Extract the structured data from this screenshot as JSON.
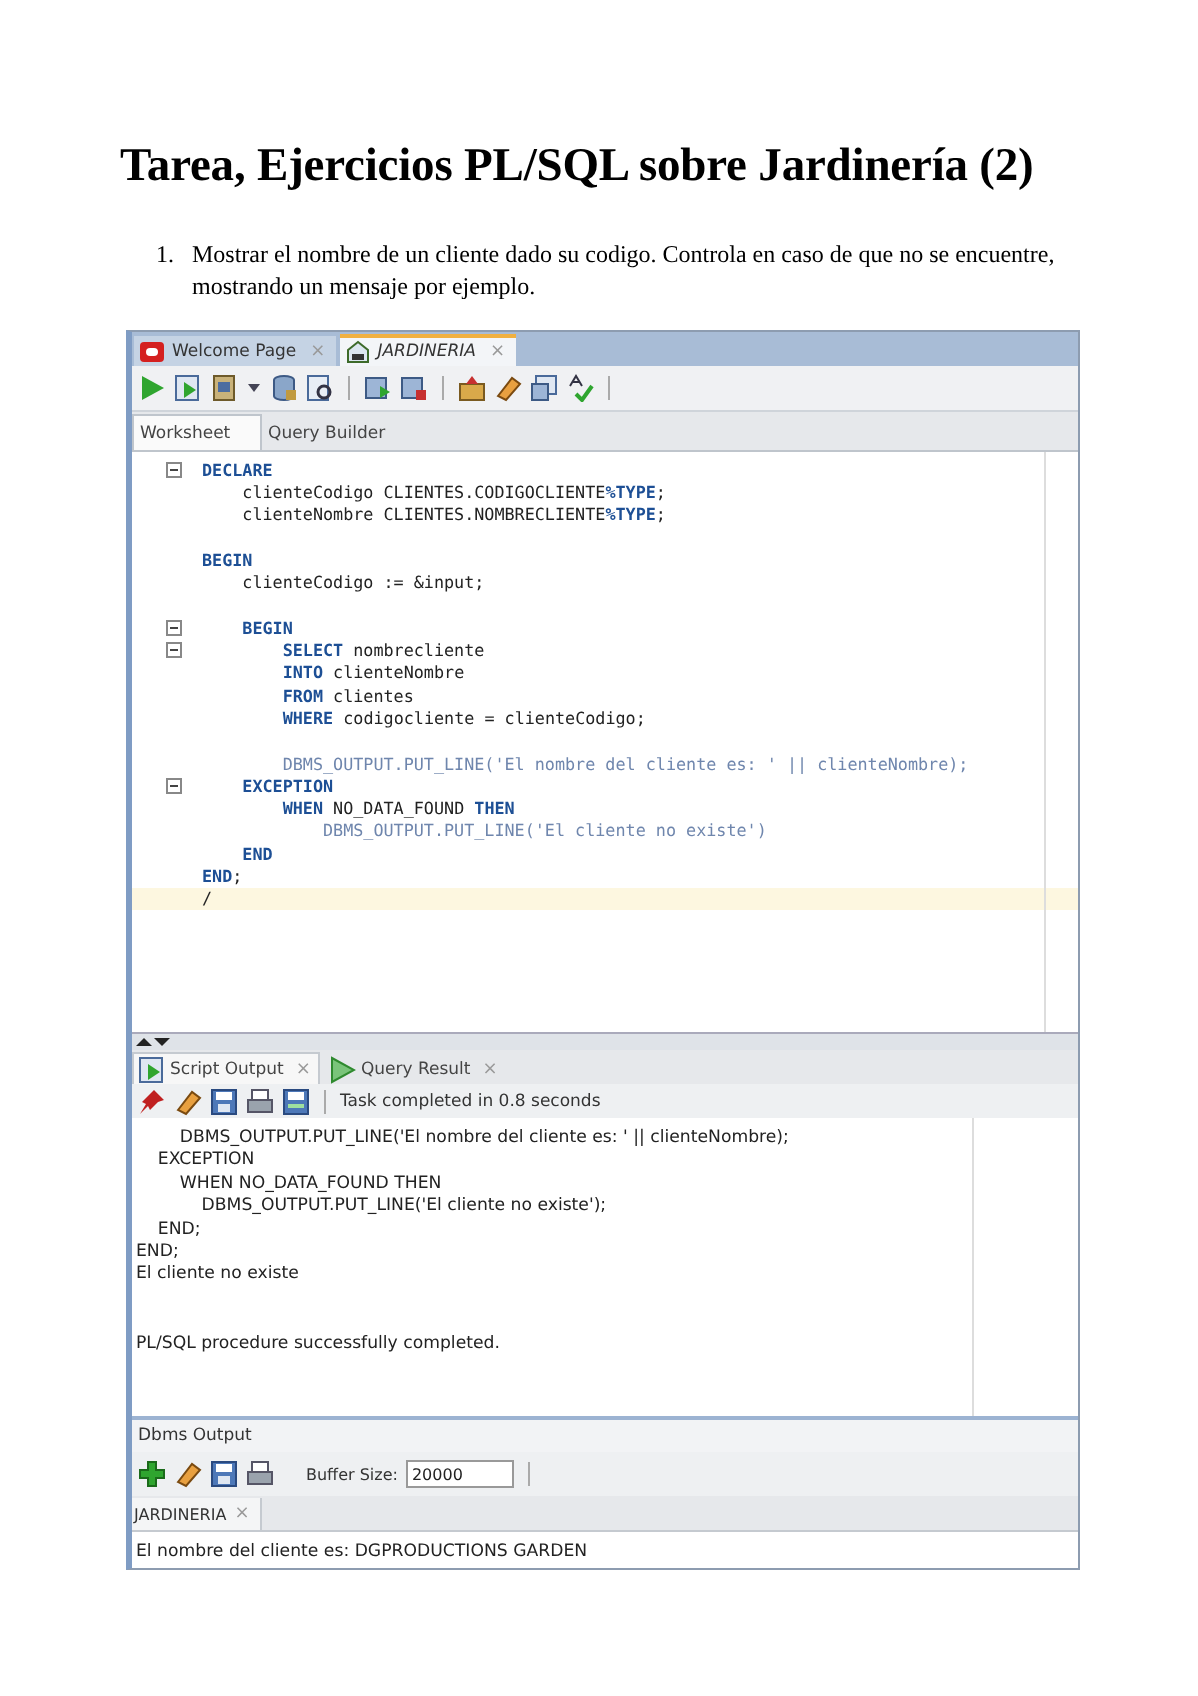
{
  "document": {
    "title": "Tarea, Ejercicios PL/SQL sobre Jardinería (2)",
    "items": [
      {
        "number": "1.",
        "text": "Mostrar el nombre de un cliente dado su codigo. Controla en caso de que no se encuentre, mostrando un mensaje por ejemplo."
      }
    ]
  },
  "editor": {
    "tabs": [
      {
        "label": "Welcome Page",
        "close": "×",
        "selected": false,
        "kind": "welcome"
      },
      {
        "label": "JARDINERIA",
        "close": "×",
        "selected": true,
        "kind": "connection"
      }
    ],
    "subtabs": [
      {
        "label": "Worksheet",
        "selected": true
      },
      {
        "label": "Query Builder",
        "selected": false
      }
    ],
    "code": [
      {
        "fold": true,
        "space_before": false,
        "current": false,
        "segments": [
          {
            "text": "DECLARE",
            "kind": "keyword"
          }
        ]
      },
      {
        "fold": false,
        "space_before": false,
        "current": false,
        "segments": [
          {
            "text": "    clienteCodigo CLIENTES.CODIGOCLIENTE",
            "kind": "plain"
          },
          {
            "text": "%TYPE",
            "kind": "keyword"
          },
          {
            "text": ";",
            "kind": "plain"
          }
        ]
      },
      {
        "fold": false,
        "space_before": false,
        "current": false,
        "segments": [
          {
            "text": "    clienteNombre CLIENTES.NOMBRECLIENTE",
            "kind": "plain"
          },
          {
            "text": "%TYPE",
            "kind": "keyword"
          },
          {
            "text": ";",
            "kind": "plain"
          }
        ]
      },
      {
        "fold": false,
        "space_before": true,
        "current": false,
        "segments": [
          {
            "text": "BEGIN",
            "kind": "keyword"
          }
        ]
      },
      {
        "fold": false,
        "space_before": false,
        "current": false,
        "segments": [
          {
            "text": "    clienteCodigo := &input;",
            "kind": "plain"
          }
        ]
      },
      {
        "fold": true,
        "space_before": true,
        "current": false,
        "segments": [
          {
            "text": "    BEGIN",
            "kind": "keyword"
          }
        ]
      },
      {
        "fold": true,
        "space_before": false,
        "current": false,
        "segments": [
          {
            "text": "        SELECT",
            "kind": "keyword"
          },
          {
            "text": " nombrecliente",
            "kind": "plain"
          }
        ]
      },
      {
        "fold": false,
        "space_before": false,
        "current": false,
        "segments": [
          {
            "text": "        INTO",
            "kind": "keyword"
          },
          {
            "text": " clienteNombre",
            "kind": "plain"
          }
        ]
      },
      {
        "fold": false,
        "space_before": false,
        "current": false,
        "segments": [
          {
            "text": "        FROM",
            "kind": "keyword"
          },
          {
            "text": " clientes",
            "kind": "plain"
          }
        ]
      },
      {
        "fold": false,
        "space_before": false,
        "current": false,
        "segments": [
          {
            "text": "        WHERE",
            "kind": "keyword"
          },
          {
            "text": " codigocliente = clienteCodigo;",
            "kind": "plain"
          }
        ]
      },
      {
        "fold": false,
        "space_before": true,
        "current": false,
        "segments": [
          {
            "text": "        DBMS_OUTPUT.PUT_LINE('El nombre del cliente es: ' || clienteNombre);",
            "kind": "builtin"
          }
        ]
      },
      {
        "fold": true,
        "space_before": false,
        "current": false,
        "segments": [
          {
            "text": "    EXCEPTION",
            "kind": "keyword"
          }
        ]
      },
      {
        "fold": false,
        "space_before": false,
        "current": false,
        "segments": [
          {
            "text": "        WHEN",
            "kind": "keyword"
          },
          {
            "text": " NO_DATA_FOUND ",
            "kind": "plain"
          },
          {
            "text": "THEN",
            "kind": "keyword"
          }
        ]
      },
      {
        "fold": false,
        "space_before": false,
        "current": false,
        "segments": [
          {
            "text": "            DBMS_OUTPUT.PUT_LINE('El cliente no existe')",
            "kind": "builtin"
          }
        ]
      },
      {
        "fold": false,
        "space_before": false,
        "current": false,
        "segments": [
          {
            "text": "    END",
            "kind": "keyword"
          }
        ]
      },
      {
        "fold": false,
        "space_before": false,
        "current": false,
        "segments": [
          {
            "text": "END",
            "kind": "keyword"
          },
          {
            "text": ";",
            "kind": "plain"
          }
        ]
      },
      {
        "fold": false,
        "space_before": false,
        "current": true,
        "segments": [
          {
            "text": "/",
            "kind": "plain"
          }
        ]
      }
    ]
  },
  "output": {
    "tabs": [
      {
        "label": "Script Output",
        "close": "×",
        "selected": true,
        "kind": "script"
      },
      {
        "label": "Query Result",
        "close": "×",
        "selected": false,
        "kind": "query"
      }
    ],
    "status": "Task completed in 0.8 seconds",
    "lines": [
      {
        "text": "        DBMS_OUTPUT.PUT_LINE('El nombre del cliente es: ' || clienteNombre);",
        "space_before": false
      },
      {
        "text": "    EXCEPTION",
        "space_before": false
      },
      {
        "text": "        WHEN NO_DATA_FOUND THEN",
        "space_before": false
      },
      {
        "text": "            DBMS_OUTPUT.PUT_LINE('El cliente no existe');",
        "space_before": false
      },
      {
        "text": "    END;",
        "space_before": false
      },
      {
        "text": "END;",
        "space_before": false
      },
      {
        "text": "El cliente no existe",
        "space_before": false
      },
      {
        "text": "PL/SQL procedure successfully completed.",
        "space_before": true
      }
    ]
  },
  "dbms": {
    "title": "Dbms Output",
    "buffer_label": "Buffer Size:",
    "buffer_value": "20000",
    "tabs": [
      {
        "label": "JARDINERIA",
        "close": "×",
        "selected": true
      }
    ],
    "lines": [
      "El nombre del cliente es: DGPRODUCTIONS GARDEN"
    ]
  }
}
